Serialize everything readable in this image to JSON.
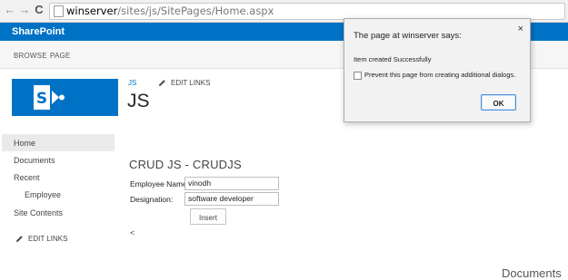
{
  "browser": {
    "nav_back": "←",
    "nav_forward": "→",
    "nav_reload": "C",
    "url_host": "winserver",
    "url_path": "/sites/js/SitePages/Home.aspx"
  },
  "suite_bar": {
    "brand": "SharePoint",
    "color": "#0072c6"
  },
  "ribbon": {
    "tabs": [
      "BROWSE",
      "PAGE"
    ]
  },
  "header": {
    "breadcrumb": "JS",
    "edit_links": "EDIT LINKS",
    "site_title": "JS"
  },
  "quick_launch": {
    "items": [
      "Home",
      "Documents",
      "Recent",
      "Employee",
      "Site Contents"
    ],
    "edit_links": "EDIT LINKS"
  },
  "main": {
    "section_title": "CRUD JS - CRUDJS",
    "fields": [
      {
        "label": "Employee Name:",
        "value": "vinodh"
      },
      {
        "label": "Designation:",
        "value": "software developer"
      }
    ],
    "insert_label": "Insert",
    "back_symbol": "<",
    "documents_heading": "Documents"
  },
  "dialog": {
    "title": "The page at winserver says:",
    "close_symbol": "×",
    "message": "Item created Successfully",
    "checkbox_label": "Prevent this page from creating additional dialogs.",
    "ok_label": "OK"
  }
}
